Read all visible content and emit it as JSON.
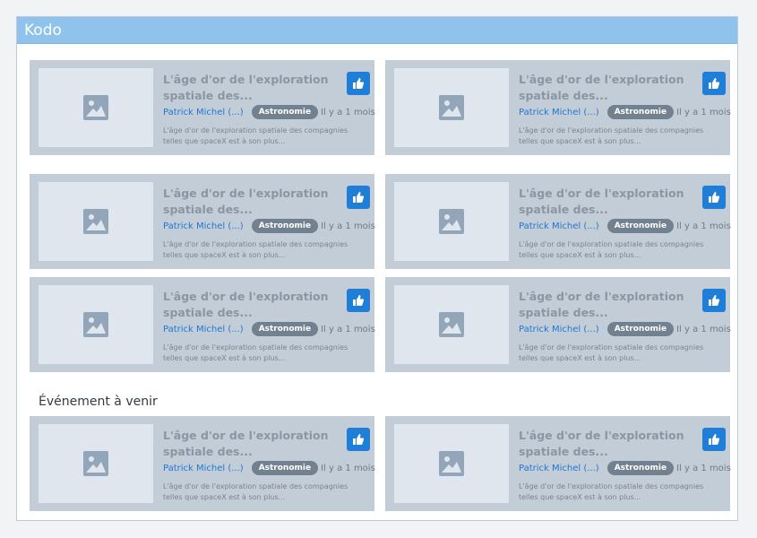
{
  "app": {
    "title": "Kodo"
  },
  "section": {
    "upcoming_label": "Événement à venir"
  },
  "cards": [
    {
      "title": "L'âge d'or de l'exploration spatiale des...",
      "author": "Patrick Michel (...)",
      "category": "Astronomie",
      "time": "Il y a 1 mois",
      "description": "L'âge d'or de l'exploration spatiale des compagnies telles que spaceX est à son plus..."
    },
    {
      "title": "L'âge d'or de l'exploration spatiale des...",
      "author": "Patrick Michel (...)",
      "category": "Astronomie",
      "time": "Il y a 1 mois",
      "description": "L'âge d'or de l'exploration spatiale des compagnies telles que spaceX est à son plus..."
    },
    {
      "title": "L'âge d'or de l'exploration spatiale des...",
      "author": "Patrick Michel (...)",
      "category": "Astronomie",
      "time": "Il y a 1 mois",
      "description": "L'âge d'or de l'exploration spatiale des compagnies telles que spaceX est à son plus..."
    },
    {
      "title": "L'âge d'or de l'exploration spatiale des...",
      "author": "Patrick Michel (...)",
      "category": "Astronomie",
      "time": "Il y a 1 mois",
      "description": "L'âge d'or de l'exploration spatiale des compagnies telles que spaceX est à son plus..."
    },
    {
      "title": "L'âge d'or de l'exploration spatiale des...",
      "author": "Patrick Michel (...)",
      "category": "Astronomie",
      "time": "Il y a 1 mois",
      "description": "L'âge d'or de l'exploration spatiale des compagnies telles que spaceX est à son plus..."
    },
    {
      "title": "L'âge d'or de l'exploration spatiale des...",
      "author": "Patrick Michel (...)",
      "category": "Astronomie",
      "time": "Il y a 1 mois",
      "description": "L'âge d'or de l'exploration spatiale des compagnies telles que spaceX est à son plus..."
    },
    {
      "title": "L'âge d'or de l'exploration spatiale des...",
      "author": "Patrick Michel (...)",
      "category": "Astronomie",
      "time": "Il y a 1 mois",
      "description": "L'âge d'or de l'exploration spatiale des compagnies telles que spaceX est à son plus..."
    },
    {
      "title": "L'âge d'or de l'exploration spatiale des...",
      "author": "Patrick Michel (...)",
      "category": "Astronomie",
      "time": "Il y a 1 mois",
      "description": "L'âge d'or de l'exploration spatiale des compagnies telles que spaceX est à son plus..."
    }
  ],
  "icons": {
    "thumbnail": "image-placeholder-icon",
    "like": "thumbs-up-icon"
  },
  "colors": {
    "header": "#90c3ec",
    "card": "#c3cdd8",
    "accent": "#1f7fd8",
    "badge": "#72818f",
    "author": "#2078d0"
  }
}
